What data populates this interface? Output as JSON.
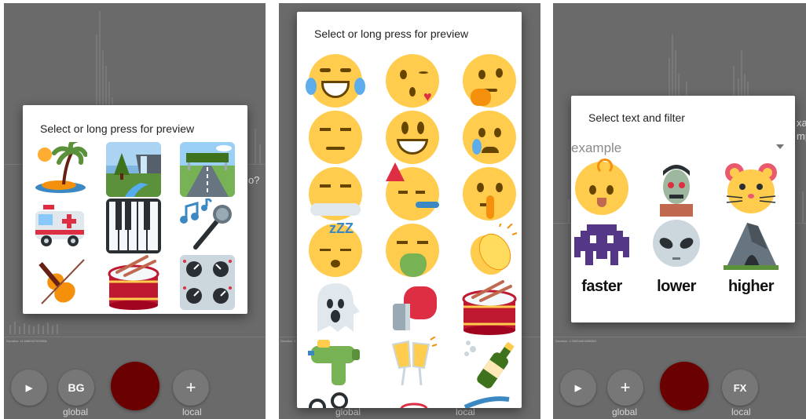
{
  "colors": {
    "screen_bg": "#6a6a6a",
    "record": "#6b0000",
    "dialog_bg": "#ffffff",
    "emoji_yellow": "#ffcc4d",
    "emoji_brown": "#664500"
  },
  "panel1": {
    "dialog_title": "Select or long press for preview",
    "side_text": "o?",
    "status_line": "Duration: 11.8480407025308 ",
    "controls": {
      "play_icon": "▶",
      "bg_label": "BG",
      "add_icon": "+",
      "global_label": "global",
      "local_label": "local"
    },
    "icons": [
      "island-icon",
      "waterfall-icon",
      "highway-icon",
      "ambulance-icon",
      "piano-keys-icon",
      "microphone-icon",
      "violin-icon",
      "drum-icon",
      "control-knobs-icon"
    ]
  },
  "panel2": {
    "dialog_title": "Select or long press for preview",
    "status_line": "Duration: 1.1",
    "controls": {
      "global_label": "global",
      "local_label": "local"
    },
    "icons": [
      "tears-of-joy-icon",
      "kissing-face-icon",
      "thinking-face-icon",
      "unamused-face-icon",
      "grinning-face-icon",
      "sad-tear-face-icon",
      "steam-face-icon",
      "party-face-icon",
      "shushing-face-icon",
      "sleeping-face-icon",
      "vomiting-face-icon",
      "clapping-hands-icon",
      "ghost-icon",
      "boxing-glove-icon",
      "drum-icon",
      "water-pistol-icon",
      "champagne-glasses-icon",
      "champagne-bottle-icon"
    ]
  },
  "panel3": {
    "dialog_title": "Select text and filter",
    "filter_value": "example",
    "side_text_top": "xa",
    "side_text_bottom": "mp",
    "status_line": "Duration: 1.00634061895484",
    "icons": [
      "baby-icon",
      "zombie-icon",
      "hamster-icon",
      "space-invader-icon",
      "alien-icon",
      "cave-icon"
    ],
    "filters": [
      "faster",
      "lower",
      "higher"
    ],
    "controls": {
      "play_icon": "▶",
      "add_icon": "+",
      "fx_label": "FX",
      "global_label": "global",
      "local_label": "local"
    }
  }
}
